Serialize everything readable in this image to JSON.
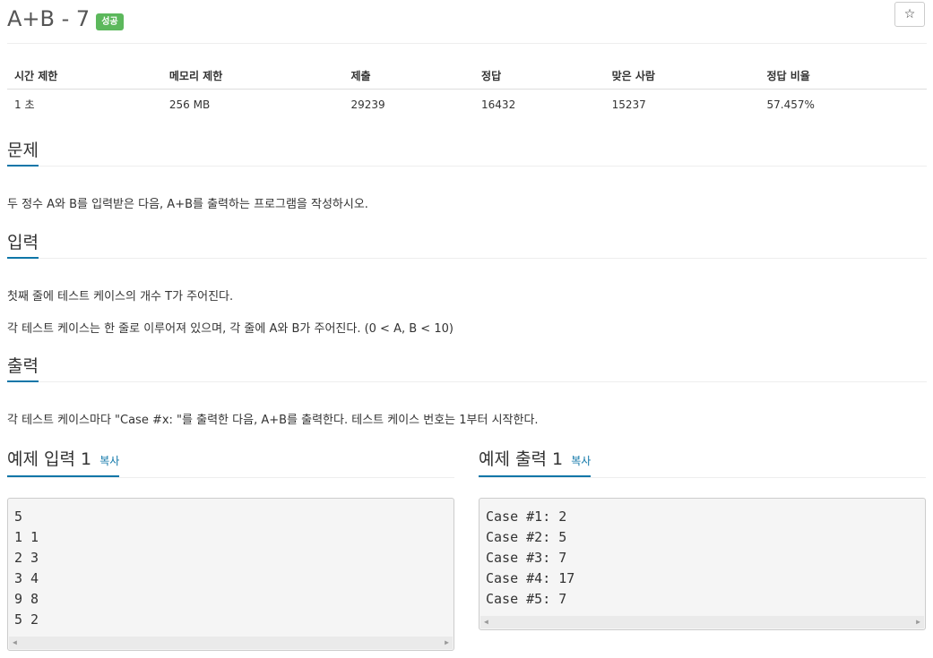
{
  "problem": {
    "title": "A+B - 7",
    "status_badge": "성공",
    "star_icon": "☆"
  },
  "info_table": {
    "headers": [
      "시간 제한",
      "메모리 제한",
      "제출",
      "정답",
      "맞은 사람",
      "정답 비율"
    ],
    "values": [
      "1 초",
      "256 MB",
      "29239",
      "16432",
      "15237",
      "57.457%"
    ]
  },
  "sections": {
    "description": {
      "heading": "문제",
      "text": "두 정수 A와 B를 입력받은 다음, A+B를 출력하는 프로그램을 작성하시오."
    },
    "input": {
      "heading": "입력",
      "lines": [
        "첫째 줄에 테스트 케이스의 개수 T가 주어진다.",
        "각 테스트 케이스는 한 줄로 이루어져 있으며, 각 줄에 A와 B가 주어진다. (0 < A, B < 10)"
      ]
    },
    "output": {
      "heading": "출력",
      "text": "각 테스트 케이스마다 \"Case #x: \"를 출력한 다음, A+B를 출력한다. 테스트 케이스 번호는 1부터 시작한다."
    }
  },
  "samples": {
    "input": {
      "heading": "예제 입력 1",
      "copy_label": "복사",
      "lines": [
        "5",
        "1 1",
        "2 3",
        "3 4",
        "9 8",
        "5 2"
      ]
    },
    "output": {
      "heading": "예제 출력 1",
      "copy_label": "복사",
      "lines": [
        "Case #1: 2",
        "Case #2: 5",
        "Case #3: 7",
        "Case #4: 17",
        "Case #5: 7"
      ]
    }
  },
  "scroll_icons": {
    "left": "◀",
    "right": "▶"
  },
  "colors": {
    "accent": "#0e76a8",
    "badge": "#5cb85c"
  }
}
